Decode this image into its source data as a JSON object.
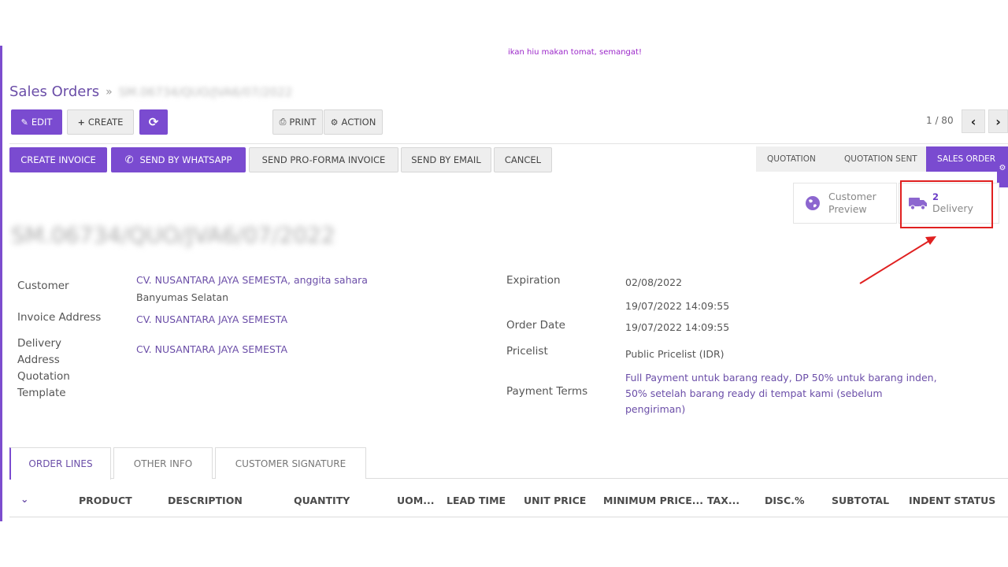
{
  "top_note": "ikan hiu makan tomat, semangat!",
  "breadcrumb": {
    "parent": "Sales Orders",
    "separator": "»",
    "current": "SM.06734/QUO/JVA6/07/2022"
  },
  "toolbar": {
    "edit": "EDIT",
    "create": "CREATE",
    "print": "PRINT",
    "action": "ACTION"
  },
  "pager": {
    "value": "1 / 80"
  },
  "actions": {
    "create_invoice": "CREATE INVOICE",
    "send_whatsapp": "SEND BY WHATSAPP",
    "send_proforma": "SEND PRO-FORMA INVOICE",
    "send_email": "SEND BY EMAIL",
    "cancel": "CANCEL"
  },
  "status_stages": [
    "QUOTATION",
    "QUOTATION SENT",
    "SALES ORDER"
  ],
  "active_stage": "SALES ORDER",
  "smart_buttons": {
    "customer_preview": {
      "line1": "Customer",
      "line2": "Preview"
    },
    "delivery": {
      "count": "2",
      "label": "Delivery"
    }
  },
  "record_name": "SM.06734/QUO/JVA6/07/2022",
  "form": {
    "customer_label": "Customer",
    "customer_value": "CV. NUSANTARA JAYA SEMESTA, anggita sahara",
    "customer_sub": "Banyumas Selatan",
    "invoice_label": "Invoice Address",
    "invoice_value": "CV. NUSANTARA JAYA SEMESTA",
    "delivery_label_1": "Delivery",
    "delivery_label_2": "Address",
    "delivery_value": "CV. NUSANTARA JAYA SEMESTA",
    "template_label_1": "Quotation",
    "template_label_2": "Template",
    "expiration_label": "Expiration",
    "expiration_value": "02/08/2022",
    "expiration_sub": "19/07/2022 14:09:55",
    "order_date_label": "Order Date",
    "order_date_value": "19/07/2022 14:09:55",
    "pricelist_label": "Pricelist",
    "pricelist_value": "Public Pricelist (IDR)",
    "payment_label": "Payment Terms",
    "payment_line1": "Full Payment untuk barang ready, DP 50% untuk barang inden,",
    "payment_line2": "50% setelah barang ready di tempat kami (sebelum",
    "payment_line3": "pengiriman)"
  },
  "tabs": [
    "ORDER LINES",
    "OTHER INFO",
    "CUSTOMER SIGNATURE"
  ],
  "table_headers": [
    "PRODUCT",
    "DESCRIPTION",
    "QUANTITY",
    "UOM...",
    "LEAD TIME",
    "UNIT PRICE",
    "MINIMUM PRICE...",
    "TAX...",
    "DISC.%",
    "SUBTOTAL",
    "INDENT STATUS"
  ],
  "colors": {
    "accent": "#7a4bd0",
    "highlight": "#e02020",
    "link": "#6b4ea8"
  }
}
